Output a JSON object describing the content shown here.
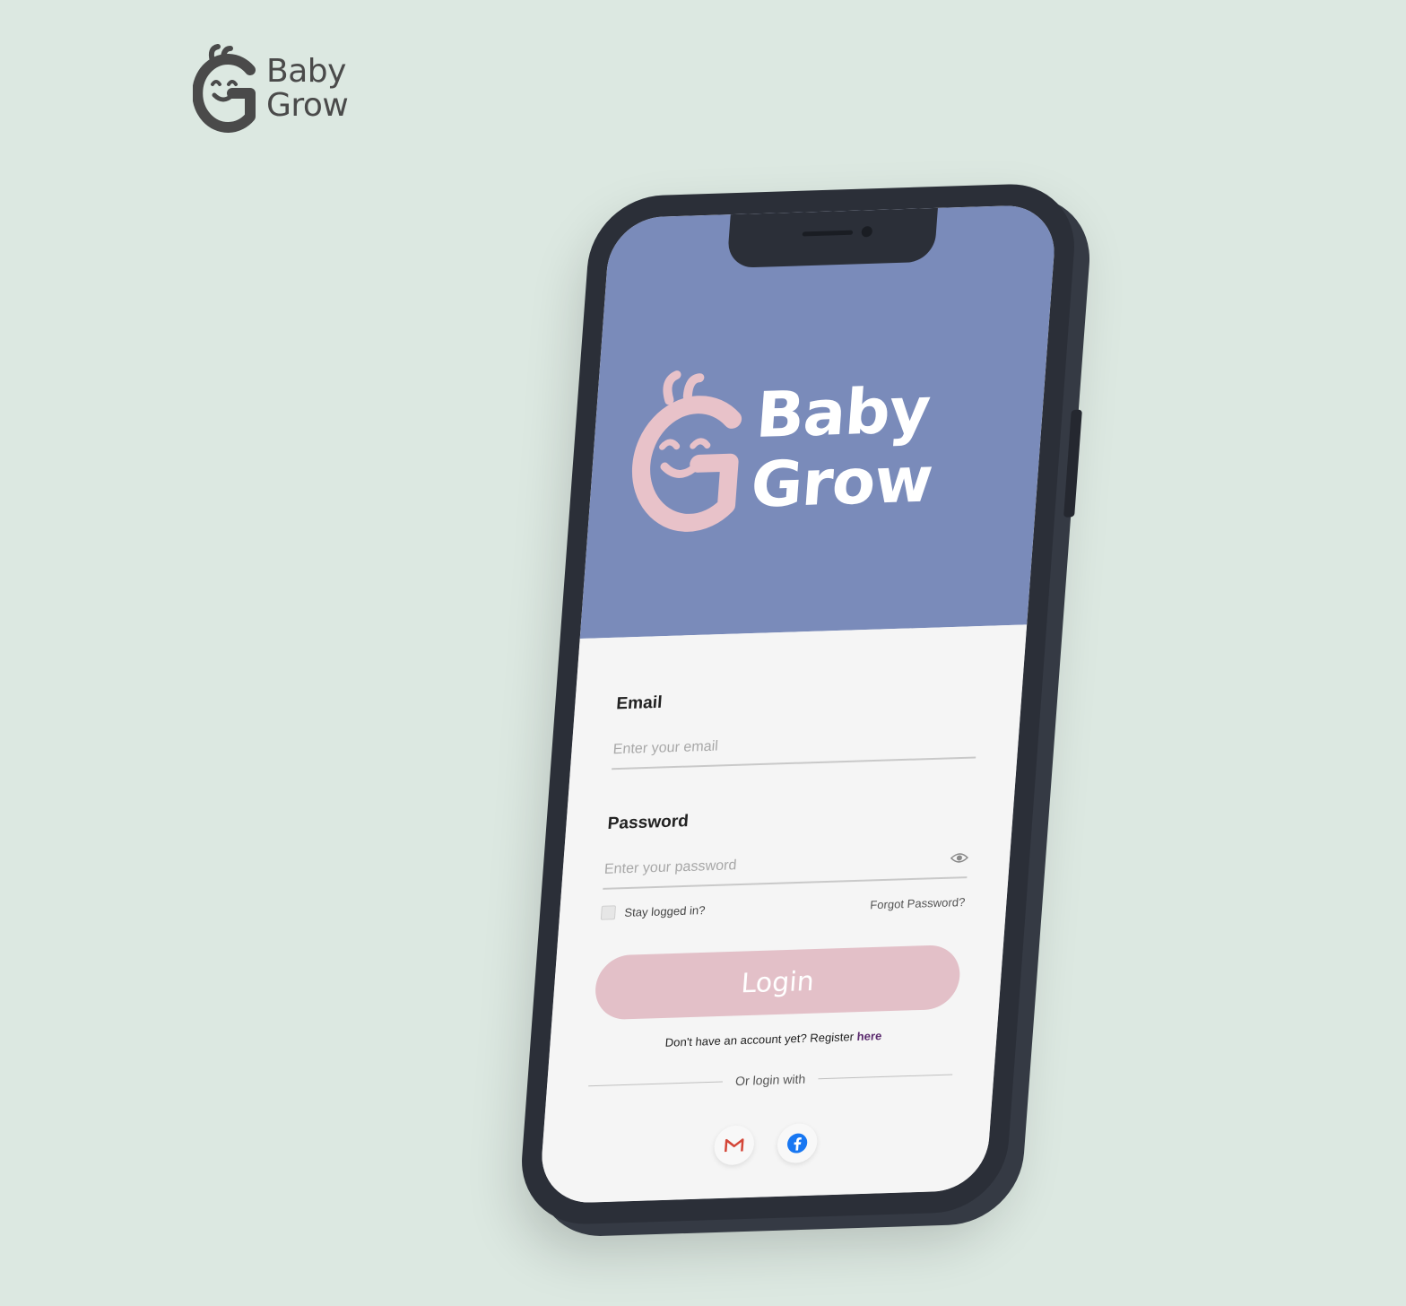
{
  "brand": {
    "line1": "Baby",
    "line2": "Grow"
  },
  "app": {
    "logo": {
      "line1": "Baby",
      "line2": "Grow"
    },
    "form": {
      "email_label": "Email",
      "email_placeholder": "Enter your email",
      "password_label": "Password",
      "password_placeholder": "Enter your password",
      "stay_logged_in": "Stay logged in?",
      "forgot_password": "Forgot Password?",
      "login_button": "Login",
      "register_prompt": "Don't have an account yet? Register",
      "register_link": "here",
      "divider_text": "Or login with"
    },
    "socials": [
      {
        "name": "gmail",
        "icon": "gmail-icon"
      },
      {
        "name": "facebook",
        "icon": "facebook-icon"
      }
    ]
  },
  "colors": {
    "background": "#dce8e1",
    "hero": "#7a8bba",
    "logo_pink": "#e8c2c9",
    "button": "#e3c0c8",
    "phone_body": "#2b2f38",
    "register_link": "#5b2a6e"
  }
}
